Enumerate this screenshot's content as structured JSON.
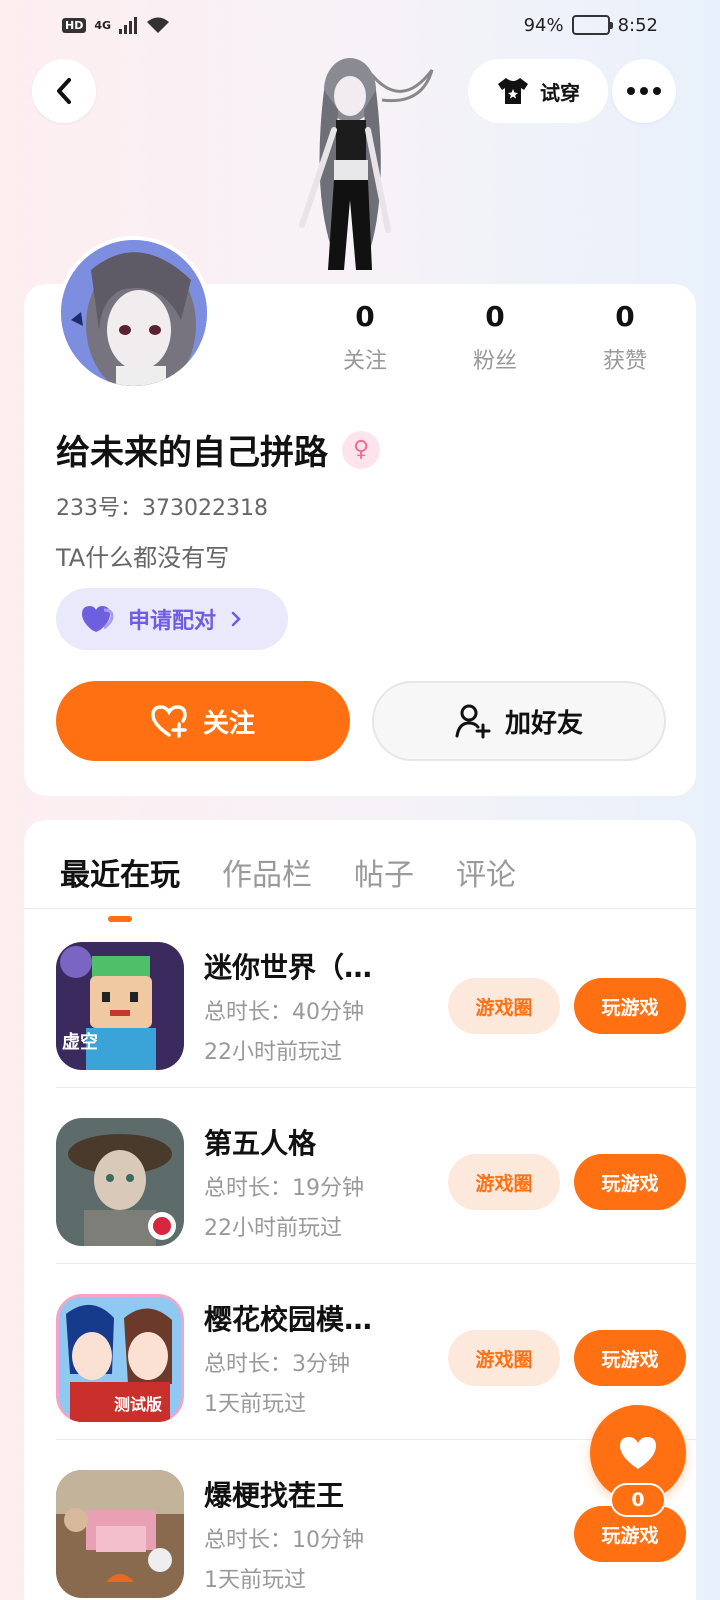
{
  "status_bar": {
    "network": "4G",
    "hd": "HD",
    "battery": "94%",
    "battery_level": 0.94,
    "time": "8:52"
  },
  "header": {
    "try_on_label": "试穿"
  },
  "profile": {
    "stats": [
      {
        "value": "0",
        "label": "关注"
      },
      {
        "value": "0",
        "label": "粉丝"
      },
      {
        "value": "0",
        "label": "获赞"
      }
    ],
    "nickname": "给未来的自己拼路",
    "gender": "female",
    "uid": "233号：373022318",
    "bio": "TA什么都没有写",
    "pair_label": "申请配对",
    "follow_label": "关注",
    "add_friend_label": "加好友"
  },
  "tabs": [
    {
      "label": "最近在玩",
      "active": true
    },
    {
      "label": "作品栏",
      "active": false
    },
    {
      "label": "帖子",
      "active": false
    },
    {
      "label": "评论",
      "active": false
    }
  ],
  "games": [
    {
      "name": "迷你世界（…",
      "duration": "总时长：40分钟",
      "last_played": "22小时前玩过",
      "circle_label": "游戏圈",
      "play_label": "玩游戏",
      "icon_badge": "虚空"
    },
    {
      "name": "第五人格",
      "duration": "总时长：19分钟",
      "last_played": "22小时前玩过",
      "circle_label": "游戏圈",
      "play_label": "玩游戏"
    },
    {
      "name": "樱花校园模…",
      "duration": "总时长：3分钟",
      "last_played": "1天前玩过",
      "circle_label": "游戏圈",
      "play_label": "玩游戏",
      "icon_badge": "测试版"
    },
    {
      "name": "爆梗找茬王",
      "duration": "总时长：10分钟",
      "last_played": "1天前玩过",
      "play_label": "玩游戏"
    }
  ],
  "like": {
    "count": "0"
  },
  "colors": {
    "accent": "#ff7012",
    "pair_bg": "#eae9fb",
    "pair_text": "#6e5ee0"
  }
}
